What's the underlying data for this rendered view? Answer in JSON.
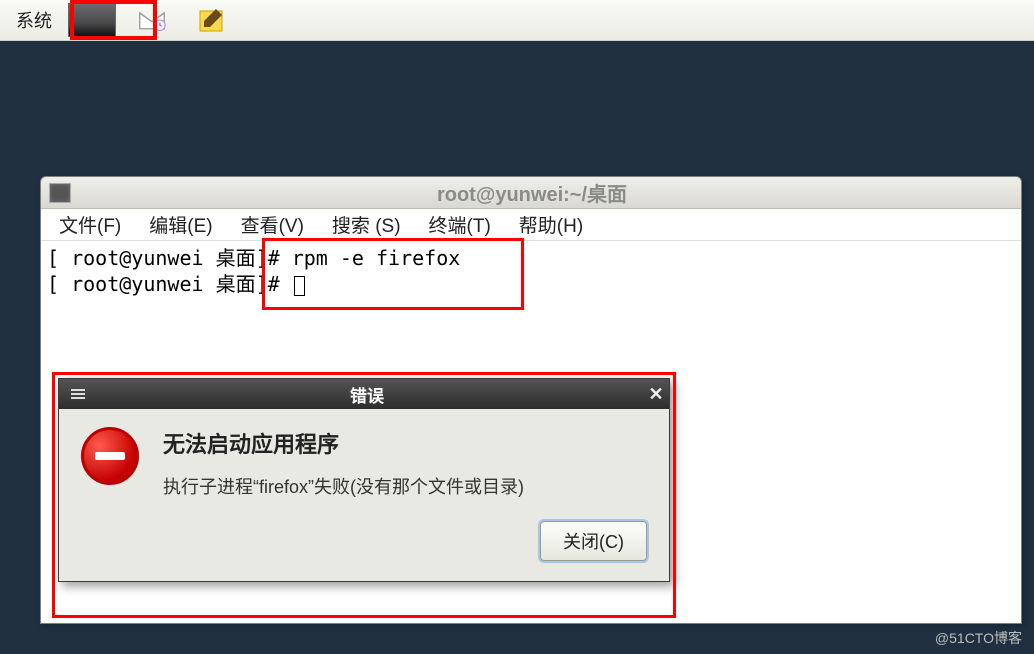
{
  "taskbar": {
    "system_label": "系统"
  },
  "terminal": {
    "title": "root@yunwei:~/桌面",
    "menus": {
      "file": "文件(F)",
      "edit": "编辑(E)",
      "view": "查看(V)",
      "search": "搜索 (S)",
      "terminal": "终端(T)",
      "help": "帮助(H)"
    },
    "line1_prompt": "[ root@yunwei 桌面]# ",
    "line1_cmd": "rpm -e firefox",
    "line2_prompt": "[ root@yunwei 桌面]# "
  },
  "dialog": {
    "title": "错误",
    "heading": "无法启动应用程序",
    "message": "执行子进程“firefox”失败(没有那个文件或目录)",
    "close_button": "关闭(C)"
  },
  "watermark": "@51CTO博客"
}
